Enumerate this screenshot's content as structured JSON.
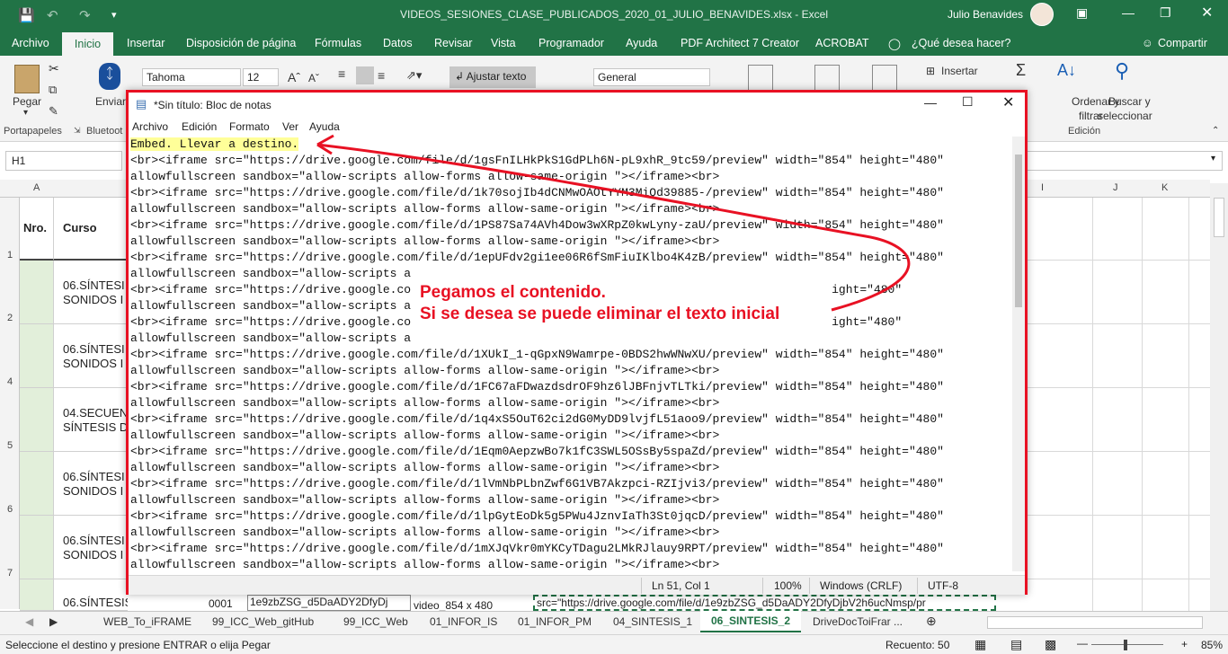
{
  "excel": {
    "window_title": "VIDEOS_SESIONES_CLASE_PUBLICADOS_2020_01_JULIO_BENAVIDES.xlsx - Excel",
    "user_name": "Julio Benavides",
    "tabs": [
      "Archivo",
      "Inicio",
      "Insertar",
      "Disposición de página",
      "Fórmulas",
      "Datos",
      "Revisar",
      "Vista",
      "Programador",
      "Ayuda",
      "PDF Architect 7 Creator",
      "ACROBAT"
    ],
    "tell_me": "¿Qué desea hacer?",
    "share": "Compartir",
    "ribbon": {
      "paste": "Pegar",
      "send": "Enviar",
      "font": "Tahoma",
      "font_size": "12",
      "wrap_text": "Ajustar texto",
      "number_format": "General",
      "insert": "Insertar",
      "sort_filter_1": "Ordenar y",
      "sort_filter_2": "filtrar",
      "find_select_1": "Buscar y",
      "find_select_2": "seleccionar",
      "group_clipboard": "Portapapeles",
      "group_bluetooth": "Bluetoot",
      "group_edit": "Edición"
    },
    "name_box": "H1",
    "columns": [
      "A",
      "I",
      "J",
      "K"
    ],
    "header_row": {
      "nro": "Nro.",
      "curso": "Curso"
    },
    "rows": [
      {
        "num": "1"
      },
      {
        "num": "2",
        "curso_l1": "06.SÍNTESI",
        "curso_l2": "SONIDOS I"
      },
      {
        "num": "4",
        "curso_l1": "06.SÍNTESI",
        "curso_l2": "SONIDOS I"
      },
      {
        "num": "5",
        "curso_l1": "04.SECUEN",
        "curso_l2": "SÍNTESIS D"
      },
      {
        "num": "6",
        "curso_l1": "06.SÍNTESI",
        "curso_l2": "SONIDOS I"
      },
      {
        "num": "7",
        "curso_l1": "06.SÍNTESI",
        "curso_l2": "SONIDOS I"
      },
      {
        "num": "",
        "curso_l1": "06.SÍNTESIS DE",
        "curso_l2": ""
      }
    ],
    "bottom_partial": {
      "id": "0001",
      "c1": "1e9zbZSG_d5DaADY2DfyDj",
      "c2": "video_854 x 480",
      "c3": "src=\"https://drive.google.com/file/d/1e9zbZSG_d5DaADY2DfyDjbV2h6ucNmsp/pr"
    },
    "sheet_tabs": [
      "WEB_To_iFRAME",
      "99_ICC_Web_gitHub",
      "99_ICC_Web",
      "01_INFOR_IS",
      "01_INFOR_PM",
      "04_SINTESIS_1",
      "06_SINTESIS_2",
      "DriveDocToiFrar ..."
    ],
    "status_text": "Seleccione el destino y presione ENTRAR o elija Pegar",
    "count_label": "Recuento: 50",
    "zoom": "85%"
  },
  "notepad": {
    "title": "*Sin título: Bloc de notas",
    "menu": [
      "Archivo",
      "Edición",
      "Formato",
      "Ver",
      "Ayuda"
    ],
    "first_line": "Embed. Llevar a destino.",
    "lines": [
      "<br><iframe src=\"https://drive.google.com/file/d/1gsFnILHkPkS1GdPLh6N-pL9xhR_9tc59/preview\" width=\"854\" height=\"480\"",
      "allowfullscreen sandbox=\"allow-scripts allow-forms allow-same-origin \"></iframe><br>",
      "<br><iframe src=\"https://drive.google.com/file/d/1k70sojIb4dCNMwOAOtYYM3MiQd39885-/preview\" width=\"854\" height=\"480\"",
      "allowfullscreen sandbox=\"allow-scripts allow-forms allow-same-origin \"></iframe><br>",
      "<br><iframe src=\"https://drive.google.com/file/d/1PS87Sa74AVh4Dow3wXRpZ0kwLyny-zaU/preview\" width=\"854\" height=\"480\"",
      "allowfullscreen sandbox=\"allow-scripts allow-forms allow-same-origin \"></iframe><br>",
      "<br><iframe src=\"https://drive.google.com/file/d/1epUFdv2gi1ee06R6fSmFiuIKlbo4K4zB/preview\" width=\"854\" height=\"480\"",
      "allowfullscreen sandbox=\"allow-scripts a",
      "<br><iframe src=\"https://drive.google.co                                                            ight=\"480\"",
      "allowfullscreen sandbox=\"allow-scripts a",
      "<br><iframe src=\"https://drive.google.co                                                            ight=\"480\"",
      "allowfullscreen sandbox=\"allow-scripts a",
      "<br><iframe src=\"https://drive.google.com/file/d/1XUkI_1-qGpxN9Wamrpe-0BDS2hwWNwXU/preview\" width=\"854\" height=\"480\"",
      "allowfullscreen sandbox=\"allow-scripts allow-forms allow-same-origin \"></iframe><br>",
      "<br><iframe src=\"https://drive.google.com/file/d/1FC67aFDwazdsdrOF9hz6lJBFnjvTLTki/preview\" width=\"854\" height=\"480\"",
      "allowfullscreen sandbox=\"allow-scripts allow-forms allow-same-origin \"></iframe><br>",
      "<br><iframe src=\"https://drive.google.com/file/d/1q4xS5OuT62ci2dG0MyDD9lvjfL51aoo9/preview\" width=\"854\" height=\"480\"",
      "allowfullscreen sandbox=\"allow-scripts allow-forms allow-same-origin \"></iframe><br>",
      "<br><iframe src=\"https://drive.google.com/file/d/1Eqm0AepzwBo7k1fC3SWL5OSsBy5spaZd/preview\" width=\"854\" height=\"480\"",
      "allowfullscreen sandbox=\"allow-scripts allow-forms allow-same-origin \"></iframe><br>",
      "<br><iframe src=\"https://drive.google.com/file/d/1lVmNbPLbnZwf6G1VB7Akzpci-RZIjvi3/preview\" width=\"854\" height=\"480\"",
      "allowfullscreen sandbox=\"allow-scripts allow-forms allow-same-origin \"></iframe><br>",
      "<br><iframe src=\"https://drive.google.com/file/d/1lpGytEoDk5g5PWu4JznvIaTh3St0jqcD/preview\" width=\"854\" height=\"480\"",
      "allowfullscreen sandbox=\"allow-scripts allow-forms allow-same-origin \"></iframe><br>",
      "<br><iframe src=\"https://drive.google.com/file/d/1mXJqVkr0mYKCyTDagu2LMkRJlauy9RPT/preview\" width=\"854\" height=\"480\"",
      "allowfullscreen sandbox=\"allow-scripts allow-forms allow-same-origin \"></iframe><br>"
    ],
    "annotation_l1": "Pegamos el contenido.",
    "annotation_l2": "Si se desea se puede eliminar el texto inicial",
    "status": {
      "position": "Ln 51, Col 1",
      "zoom": "100%",
      "eol": "Windows (CRLF)",
      "encoding": "UTF-8"
    },
    "accent_color": "#e81123"
  }
}
